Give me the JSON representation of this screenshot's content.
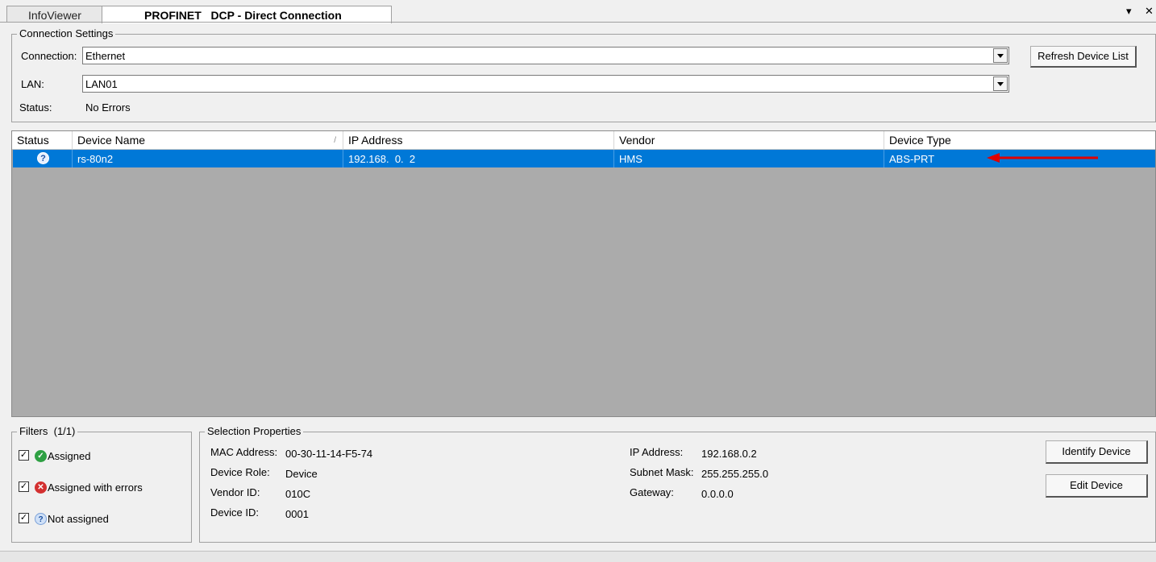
{
  "tabs": {
    "infoviewer": "InfoViewer",
    "profinet": "PROFINET   DCP - Direct Connection"
  },
  "tab_controls": {
    "dropdown": "▾",
    "close": "✕"
  },
  "connection_settings": {
    "title": "Connection Settings",
    "connection_label": "Connection:",
    "connection_value": "Ethernet",
    "lan_label": "LAN:",
    "lan_value": "LAN01",
    "status_label": "Status:",
    "status_value": "No Errors",
    "refresh_button": "Refresh Device List"
  },
  "device_table": {
    "columns": [
      "Status",
      "Device Name",
      "IP Address",
      "Vendor",
      "Device Type"
    ],
    "sort_indicator": "/",
    "rows": [
      {
        "status_icon": "question-icon",
        "status_glyph": "?",
        "device_name": "rs-80n2",
        "ip": "192.168.  0.  2",
        "vendor": "HMS",
        "device_type": "ABS-PRT"
      }
    ]
  },
  "annotation": {
    "color": "#e00000",
    "icon": "red-arrow-icon"
  },
  "filters": {
    "title": "Filters  (1/1)",
    "items": [
      {
        "label": "Assigned",
        "checked": true,
        "icon": "green-check-icon",
        "color": "#2ea043",
        "glyph": "✓"
      },
      {
        "label": "Assigned with errors",
        "checked": true,
        "icon": "red-x-icon",
        "color": "#d33030",
        "glyph": "✕"
      },
      {
        "label": "Not assigned",
        "checked": true,
        "icon": "question-icon",
        "color": "#cfe0f7",
        "glyph": "?"
      }
    ]
  },
  "selection_properties": {
    "title": "Selection Properties",
    "mac_label": "MAC Address:",
    "mac_value": "00-30-11-14-F5-74",
    "role_label": "Device Role:",
    "role_value": "Device",
    "vendor_id_label": "Vendor ID:",
    "vendor_id_value": "010C",
    "device_id_label": "Device ID:",
    "device_id_value": "0001",
    "ip_label": "IP Address:",
    "ip_value": "192.168.0.2",
    "subnet_label": "Subnet Mask:",
    "subnet_value": "255.255.255.0",
    "gateway_label": "Gateway:",
    "gateway_value": "0.0.0.0",
    "identify_button": "Identify Device",
    "edit_button": "Edit Device"
  },
  "colors": {
    "selection": "#0078d7",
    "table_bg": "#ababab",
    "window_bg": "#f0f0f0"
  }
}
